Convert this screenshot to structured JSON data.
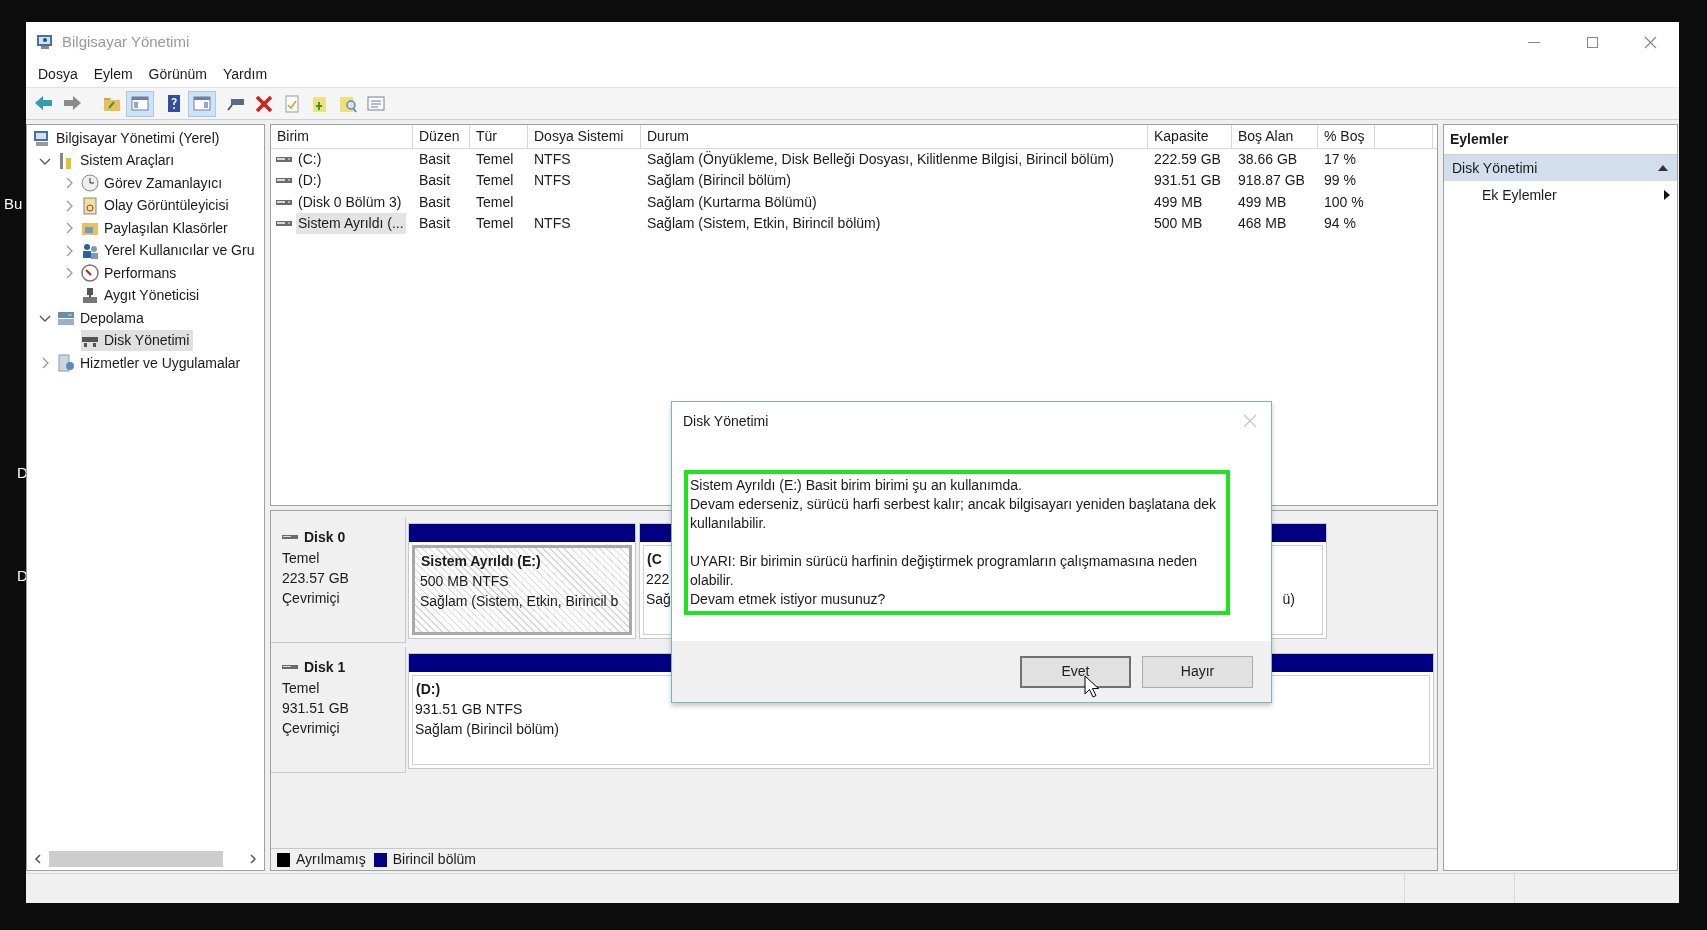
{
  "desktop_labels": [
    "Bu",
    "D",
    "D"
  ],
  "window": {
    "title": "Bilgisayar Yönetimi"
  },
  "menu": [
    "Dosya",
    "Eylem",
    "Görünüm",
    "Yardım"
  ],
  "toolbar": [
    {
      "pressed": false
    },
    {
      "pressed": false
    },
    {
      "pressed": false
    },
    {
      "pressed": true
    },
    {
      "pressed": false
    },
    {
      "pressed": true
    },
    {
      "pressed": false
    },
    {
      "pressed": false
    },
    {
      "pressed": false
    },
    {
      "pressed": false
    },
    {
      "pressed": false
    },
    {
      "pressed": false
    }
  ],
  "tree": [
    {
      "label": "Bilgisayar Yönetimi (Yerel)",
      "selected": false,
      "children": [
        {
          "label": "Sistem Araçları",
          "expanded": true,
          "selected": false,
          "children": [
            {
              "label": "Görev Zamanlayıcı",
              "expanded": false,
              "selected": false
            },
            {
              "label": "Olay Görüntüleyicisi",
              "expanded": false,
              "selected": false
            },
            {
              "label": "Paylaşılan Klasörler",
              "expanded": false,
              "selected": false
            },
            {
              "label": "Yerel Kullanıcılar ve Gru",
              "expanded": false,
              "selected": false
            },
            {
              "label": "Performans",
              "expanded": false,
              "selected": false
            },
            {
              "label": "Aygıt Yöneticisi",
              "selected": false
            }
          ]
        },
        {
          "label": "Depolama",
          "expanded": true,
          "selected": false,
          "children": [
            {
              "label": "Disk Yönetimi",
              "selected": true
            }
          ]
        },
        {
          "label": "Hizmetler ve Uygulamalar",
          "expanded": false,
          "selected": false
        }
      ]
    }
  ],
  "table": {
    "columns": [
      "Birim",
      "Düzen",
      "Tür",
      "Dosya Sistemi",
      "Durum",
      "Kapasite",
      "Boş Alan",
      "% Boş"
    ],
    "rows": [
      {
        "cells": [
          "(C:)",
          "Basit",
          "Temel",
          "NTFS",
          "Sağlam (Önyükleme, Disk Belleği Dosyası, Kilitlenme Bilgisi, Birincil bölüm)",
          "222.59 GB",
          "38.66 GB",
          "17 %"
        ],
        "selected": false
      },
      {
        "cells": [
          "(D:)",
          "Basit",
          "Temel",
          "NTFS",
          "Sağlam (Birincil bölüm)",
          "931.51 GB",
          "918.87 GB",
          "99 %"
        ],
        "selected": false
      },
      {
        "cells": [
          "(Disk 0 Bölüm 3)",
          "Basit",
          "Temel",
          null,
          "Sağlam (Kurtarma Bölümü)",
          "499 MB",
          "499 MB",
          "100 %"
        ],
        "selected": false
      },
      {
        "cells": [
          "Sistem Ayrıldı (...",
          "Basit",
          "Temel",
          "NTFS",
          "Sağlam (Sistem, Etkin, Birincil bölüm)",
          "500 MB",
          "468 MB",
          "94 %"
        ],
        "selected": true
      }
    ]
  },
  "disks": [
    {
      "name": "Disk 0",
      "type": "Temel",
      "size": "223.57 GB",
      "status": "Çevrimiçi",
      "partitions": [
        {
          "title": "Sistem Ayrıldı  (E:)",
          "size_fs": "500 MB NTFS",
          "status": "Sağlam (Sistem, Etkin, Birincil b",
          "selected": true
        },
        {
          "title": "(C",
          "size_fs": "222",
          "status": "Sağ",
          "status_tail": "ü)",
          "selected": false
        }
      ]
    },
    {
      "name": "Disk 1",
      "type": "Temel",
      "size": "931.51 GB",
      "status": "Çevrimiçi",
      "partitions": [
        {
          "title": "(D:)",
          "size_fs": "931.51 GB NTFS",
          "status": "Sağlam (Birincil bölüm)",
          "selected": false
        }
      ]
    }
  ],
  "legend": [
    {
      "label": "Ayrılmamış",
      "color": "#000000"
    },
    {
      "label": "Birincil bölüm",
      "color": "#000080"
    }
  ],
  "actions": {
    "header": "Eylemler",
    "items": [
      {
        "label": "Disk Yönetimi",
        "kind": "section"
      },
      {
        "label": "Ek Eylemler",
        "kind": "submenu"
      }
    ]
  },
  "dialog": {
    "title": "Disk Yönetimi",
    "message": [
      [
        "Sistem Ayrıldı (E:) Basit birim birimi şu an kullanımda.",
        "Devam ederseniz, sürücü harfi serbest kalır; ancak bilgisayarı yeniden başlatana dek kullanılabilir."
      ],
      [
        "UYARI: Bir birimin sürücü harfinin değiştirmek programların çalışmamasına neden olabilir.",
        "Devam etmek istiyor musunuz?"
      ]
    ],
    "buttons": [
      {
        "label": "Evet",
        "focused": true
      },
      {
        "label": "Hayır",
        "focused": false
      }
    ]
  }
}
